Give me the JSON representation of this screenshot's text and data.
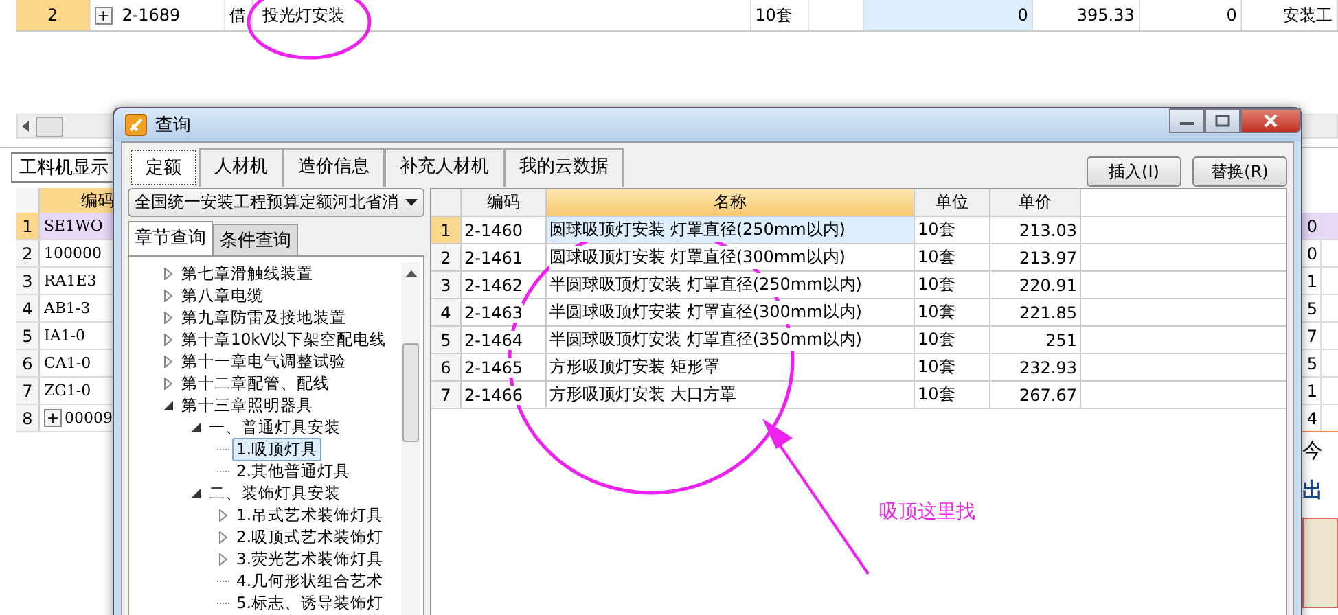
{
  "main_table": {
    "row": {
      "index": "2",
      "expand": "+",
      "code": "2-1689",
      "type": "借",
      "name": "投光灯安装",
      "unit": "10套",
      "quantity": "0",
      "price": "395.33",
      "amount": "0",
      "category": "安装工"
    }
  },
  "bottom_panel": {
    "tab": "工料机显示",
    "header": "编码",
    "rows": [
      {
        "index": "1",
        "code": "SE1WO",
        "value": "0",
        "selected": true
      },
      {
        "index": "2",
        "code": "100000",
        "value": "0",
        "selected": false
      },
      {
        "index": "3",
        "code": "RA1E3",
        "value": "1",
        "selected": false
      },
      {
        "index": "4",
        "code": "AB1-3",
        "value": "5",
        "selected": false
      },
      {
        "index": "5",
        "code": "IA1-0",
        "value": "7",
        "selected": false
      },
      {
        "index": "6",
        "code": "CA1-0",
        "value": "5",
        "selected": false
      },
      {
        "index": "7",
        "code": "ZG1-0",
        "value": "1",
        "selected": false
      },
      {
        "index": "8",
        "code": "00009",
        "value": "4",
        "expand": "+",
        "selected": false
      }
    ]
  },
  "side_news": {
    "line_1": "今",
    "line_2": "出"
  },
  "dialog": {
    "title": "查询",
    "tabs": [
      {
        "label": "定额",
        "selected": true
      },
      {
        "label": "人材机",
        "selected": false
      },
      {
        "label": "造价信息",
        "selected": false
      },
      {
        "label": "补充人材机",
        "selected": false
      },
      {
        "label": "我的云数据",
        "selected": false
      }
    ],
    "buttons": [
      "插入(I)",
      "替换(R)"
    ],
    "library": "全国统一安装工程预算定额河北省消",
    "subtabs": [
      {
        "label": "章节查询",
        "selected": true
      },
      {
        "label": "条件查询",
        "selected": false
      }
    ],
    "tree": [
      {
        "label": "第七章滑触线装置",
        "expanded": false,
        "selected": false
      },
      {
        "label": "第八章电缆",
        "expanded": false,
        "selected": false
      },
      {
        "label": "第九章防雷及接地装置",
        "expanded": false,
        "selected": false
      },
      {
        "label": "第十章10kV以下架空配电线",
        "expanded": false,
        "selected": false
      },
      {
        "label": "第十一章电气调整试验",
        "expanded": false,
        "selected": false
      },
      {
        "label": "第十二章配管、配线",
        "expanded": false,
        "selected": false
      },
      {
        "label": "第十三章照明器具",
        "expanded": true,
        "selected": false,
        "children": [
          {
            "label": "一、普通灯具安装",
            "expanded": true,
            "selected": false,
            "children": [
              {
                "label": "1.吸顶灯具",
                "selected": true
              },
              {
                "label": "2.其他普通灯具",
                "selected": false
              }
            ]
          },
          {
            "label": "二、装饰灯具安装",
            "expanded": true,
            "selected": false,
            "children": [
              {
                "label": "1.吊式艺术装饰灯具",
                "expanded": false,
                "selected": false
              },
              {
                "label": "2.吸顶式艺术装饰灯",
                "expanded": false,
                "selected": false
              },
              {
                "label": "3.荧光艺术装饰灯具",
                "expanded": false,
                "selected": false
              },
              {
                "label": "4.几何形状组合艺术",
                "selected": false
              },
              {
                "label": "5.标志、诱导装饰灯",
                "selected": false
              }
            ]
          }
        ]
      }
    ],
    "grid": {
      "columns": [
        "编码",
        "名称",
        "单位",
        "单价"
      ],
      "rows": [
        {
          "index": "1",
          "code": "2-1460",
          "name": "圆球吸顶灯安装 灯罩直径(250mm以内)",
          "unit": "10套",
          "price": "213.03",
          "selected": true
        },
        {
          "index": "2",
          "code": "2-1461",
          "name": "圆球吸顶灯安装 灯罩直径(300mm以内)",
          "unit": "10套",
          "price": "213.97",
          "selected": false
        },
        {
          "index": "3",
          "code": "2-1462",
          "name": "半圆球吸顶灯安装 灯罩直径(250mm以内)",
          "unit": "10套",
          "price": "220.91",
          "selected": false
        },
        {
          "index": "4",
          "code": "2-1463",
          "name": "半圆球吸顶灯安装 灯罩直径(300mm以内)",
          "unit": "10套",
          "price": "221.85",
          "selected": false
        },
        {
          "index": "5",
          "code": "2-1464",
          "name": "半圆球吸顶灯安装 灯罩直径(350mm以内)",
          "unit": "10套",
          "price": "251",
          "selected": false
        },
        {
          "index": "6",
          "code": "2-1465",
          "name": "方形吸顶灯安装 矩形罩",
          "unit": "10套",
          "price": "232.93",
          "selected": false
        },
        {
          "index": "7",
          "code": "2-1466",
          "name": "方形吸顶灯安装 大口方罩",
          "unit": "10套",
          "price": "267.67",
          "selected": false
        }
      ]
    }
  },
  "annotation": {
    "text": "吸顶这里找"
  }
}
